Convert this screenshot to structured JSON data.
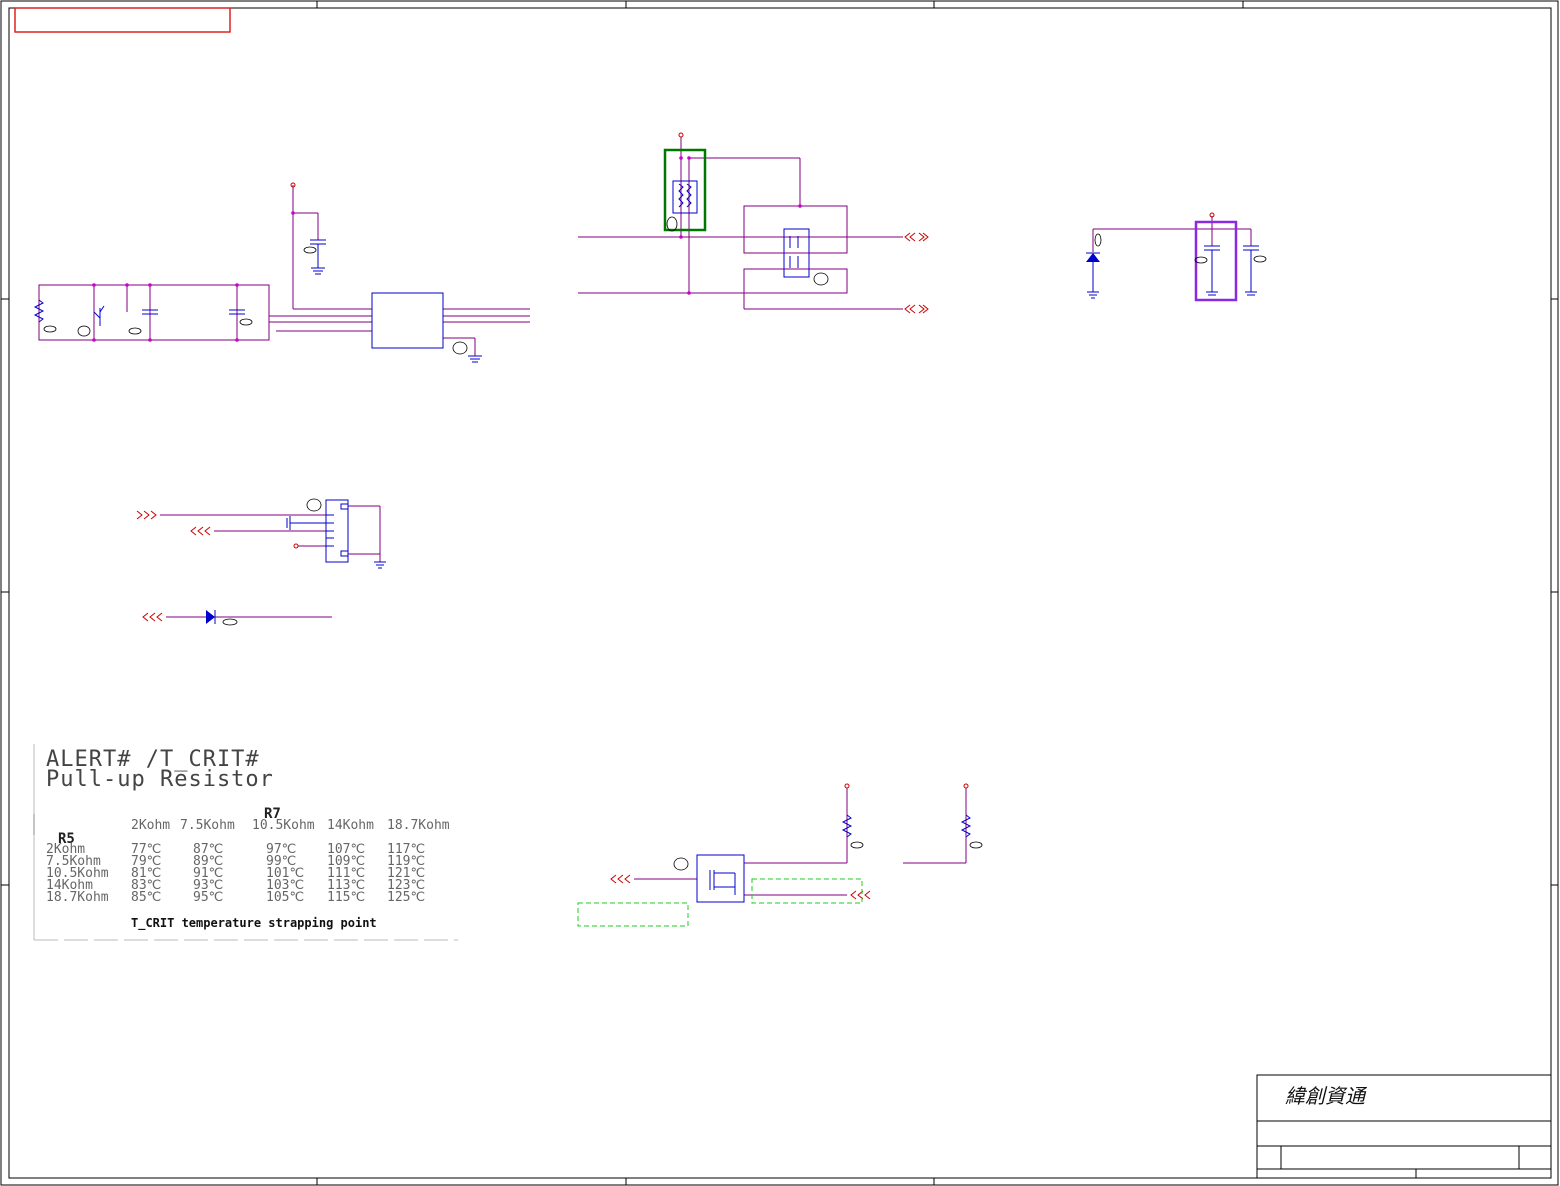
{
  "table": {
    "title_line1": "ALERT# /T_CRIT#",
    "title_line2": "Pull-up Resistor",
    "col_header": "R7",
    "row_header": "R5",
    "columns": [
      "2Kohm",
      "7.5Kohm",
      "10.5Kohm",
      "14Kohm",
      "18.7Kohm"
    ],
    "rows": [
      {
        "label": "2Kohm",
        "values": [
          "77℃",
          "87℃",
          "97℃",
          "107℃",
          "117℃"
        ]
      },
      {
        "label": "7.5Kohm",
        "values": [
          "79℃",
          "89℃",
          "99℃",
          "109℃",
          "119℃"
        ]
      },
      {
        "label": "10.5Kohm",
        "values": [
          "81℃",
          "91℃",
          "101℃",
          "111℃",
          "121℃"
        ]
      },
      {
        "label": "14Kohm",
        "values": [
          "83℃",
          "93℃",
          "103℃",
          "113℃",
          "123℃"
        ]
      },
      {
        "label": "18.7Kohm",
        "values": [
          "85℃",
          "95℃",
          "105℃",
          "115℃",
          "125℃"
        ]
      }
    ],
    "note": "T_CRIT temperature strapping point"
  },
  "title_block": {
    "company": "緯創資通"
  },
  "colors": {
    "wire": "#800080",
    "signal": "#cc0000",
    "component": "#0000cc",
    "highlight_green": "#007700",
    "highlight_purple": "#8a2be2",
    "dashed_box": "#22cc22",
    "border": "#000000"
  }
}
